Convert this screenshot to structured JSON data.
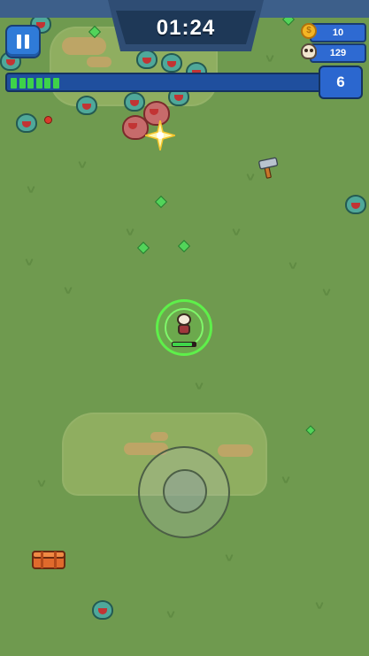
{
  "hud": {
    "timer": "01:24",
    "coins": "10",
    "kills": "129",
    "level": "6",
    "xp_progress": 0.17
  },
  "player": {
    "hp_fraction": 0.85
  },
  "colors": {
    "grass": "#6f9a4f",
    "xp_fill": "#3ed24a",
    "aura": "#5ef04a",
    "hud_blue": "#2e6ad2"
  },
  "icons": {
    "pause": "pause-icon",
    "coin": "coin-icon",
    "kills": "skull-icon",
    "weapon_pickup": "hammer-icon",
    "loot": "chest-icon"
  }
}
